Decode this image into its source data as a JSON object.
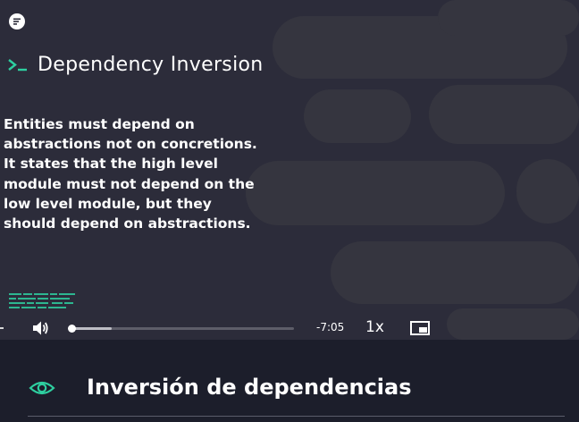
{
  "slide": {
    "title": "Dependency Inversion",
    "body": "Entities must depend on abstractions not on concretions. It states that the high level module must not depend on the low level module, but they should depend on abstractions."
  },
  "player": {
    "time_remaining": "-7:05",
    "speed": "1x",
    "progress": 0.18
  },
  "lesson": {
    "title": "Inversión de dependencias"
  },
  "colors": {
    "accent": "#2ecfa0",
    "video_bg": "#2c2c3a",
    "page_bg": "#1c1e2b"
  },
  "icons": {
    "logo": "logo-icon",
    "prompt": "terminal-prompt-icon",
    "volume": "volume-icon",
    "pip": "picture-in-picture-icon",
    "eye": "eye-icon"
  }
}
